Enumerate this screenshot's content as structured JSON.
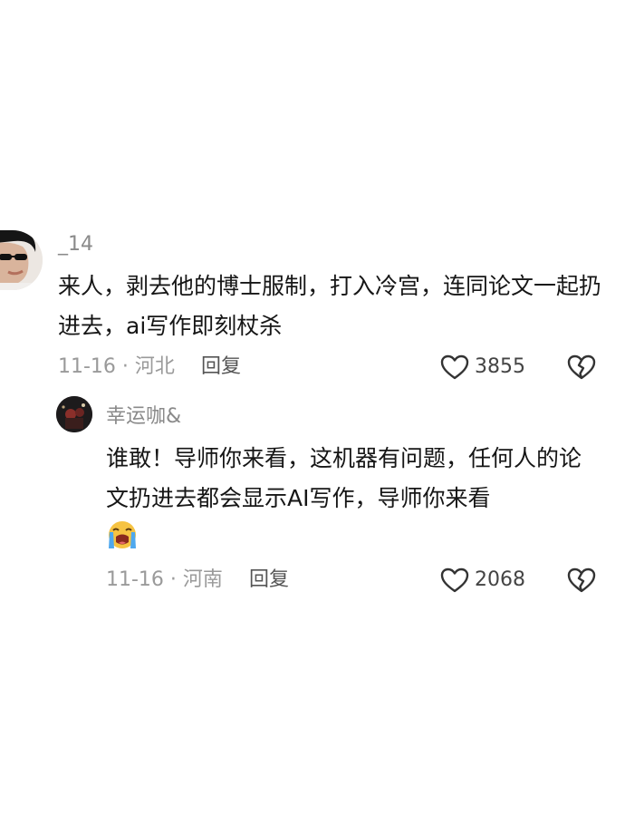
{
  "comments": [
    {
      "username": "_14",
      "text": "来人，剥去他的博士服制，打入冷宫，连同论文一起扔进去，ai写作即刻杖杀",
      "date": "11-16",
      "location": "河北",
      "reply_label": "回复",
      "likes": "3855",
      "avatar_icon": "sunglasses-portrait-avatar"
    },
    {
      "username": "幸运咖&",
      "text": "谁敢！导师你来看，这机器有问题，任何人的论文扔进去都会显示AI写作，导师你来看",
      "emoji": "loudly-crying-face-emoji",
      "date": "11-16",
      "location": "河南",
      "reply_label": "回复",
      "likes": "2068",
      "avatar_icon": "dark-photo-avatar"
    }
  ],
  "colors": {
    "text": "#161616",
    "meta": "#9a9a9a",
    "username": "#8a8a8a"
  }
}
